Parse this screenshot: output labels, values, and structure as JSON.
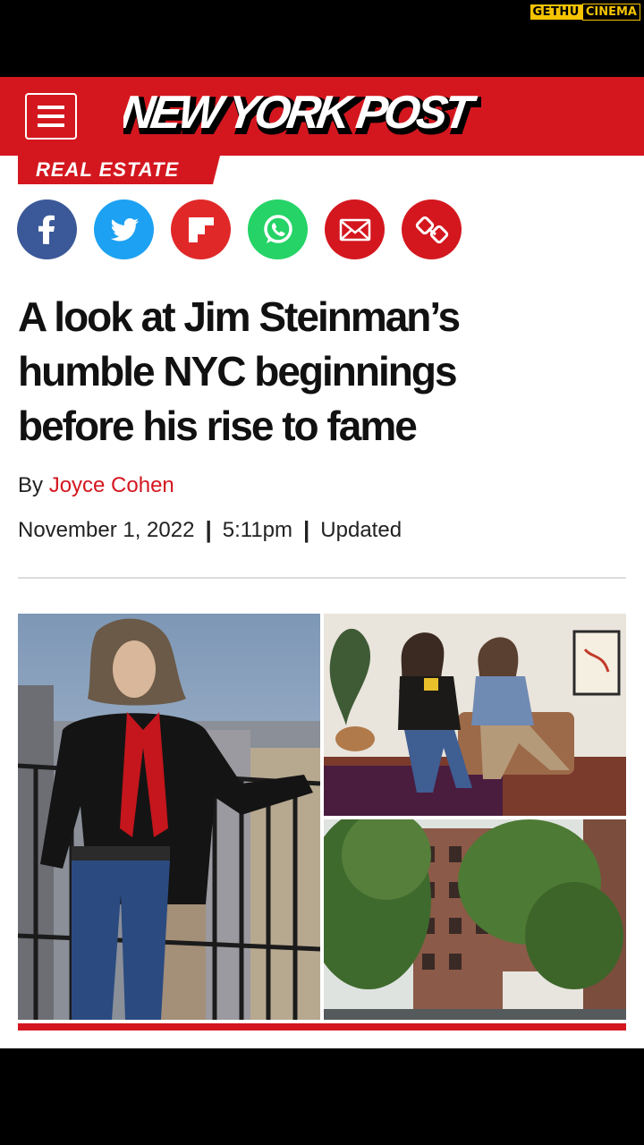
{
  "watermark": {
    "part1": "GETHU",
    "part2": "CINEMA"
  },
  "header": {
    "logo_text": "NEW YORK POST",
    "menu_icon": "hamburger-menu-icon",
    "brand_color": "#d4171f"
  },
  "section": {
    "label": "REAL ESTATE"
  },
  "share": [
    {
      "name": "facebook",
      "icon": "facebook-icon",
      "color": "#3b5998"
    },
    {
      "name": "twitter",
      "icon": "twitter-icon",
      "color": "#1da1f2"
    },
    {
      "name": "flipboard",
      "icon": "flipboard-icon",
      "color": "#e12828"
    },
    {
      "name": "whatsapp",
      "icon": "whatsapp-icon",
      "color": "#25d366"
    },
    {
      "name": "email",
      "icon": "mail-icon",
      "color": "#d4171f"
    },
    {
      "name": "copy-link",
      "icon": "link-icon",
      "color": "#d4171f"
    }
  ],
  "article": {
    "headline_lines": [
      "A look at Jim Steinman’s",
      "humble NYC beginnings",
      "before his rise to fame"
    ],
    "by": "By",
    "author": "Joyce Cohen",
    "date": "November 1, 2022",
    "time": "5:11pm",
    "updated": "Updated",
    "separator": "|"
  }
}
